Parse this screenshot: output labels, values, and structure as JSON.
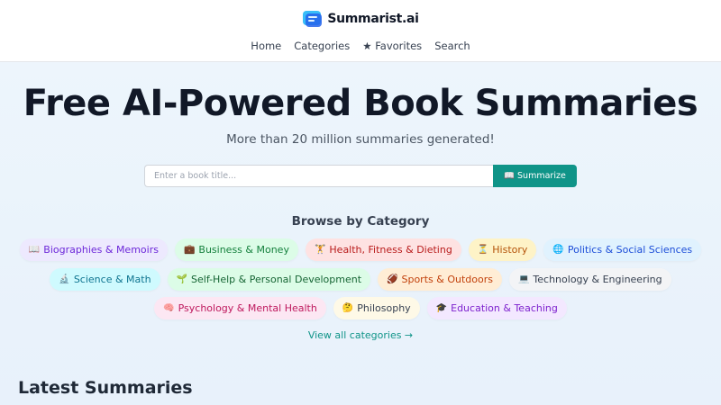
{
  "header": {
    "logo_text": "Summarist.ai",
    "nav": [
      {
        "label": "Home"
      },
      {
        "label": "Categories"
      },
      {
        "label": "★ Favorites"
      },
      {
        "label": "Search"
      }
    ]
  },
  "hero": {
    "title": "Free AI-Powered Book Summaries",
    "subtitle": "More than 20 million summaries generated!"
  },
  "search": {
    "placeholder": "Enter a book title...",
    "value": "",
    "button_label": "Summarize",
    "button_icon": "📖"
  },
  "browse": {
    "title": "Browse by Category",
    "categories": [
      {
        "icon": "📖",
        "label": "Biographies & Memoirs",
        "color": "#6d28d9"
      },
      {
        "icon": "💼",
        "label": "Business & Money",
        "color": "#15803d"
      },
      {
        "icon": "🏋",
        "label": "Health, Fitness & Dieting",
        "color": "#b91c1c"
      },
      {
        "icon": "⏳",
        "label": "History",
        "color": "#b45309"
      },
      {
        "icon": "🌐",
        "label": "Politics & Social Sciences",
        "color": "#1d4ed8"
      },
      {
        "icon": "🔬",
        "label": "Science & Math",
        "color": "#0e7490"
      },
      {
        "icon": "🌱",
        "label": "Self-Help & Personal Development",
        "color": "#166534"
      },
      {
        "icon": "🏈",
        "label": "Sports & Outdoors",
        "color": "#c2410c"
      },
      {
        "icon": "💻",
        "label": "Technology & Engineering",
        "color": "#374151"
      },
      {
        "icon": "🧠",
        "label": "Psychology & Mental Health",
        "color": "#be185d"
      },
      {
        "icon": "🤔",
        "label": "Philosophy",
        "color": "#374151"
      },
      {
        "icon": "🎓",
        "label": "Education & Teaching",
        "color": "#7e22ce"
      }
    ],
    "view_all_label": "View all categories →"
  },
  "latest": {
    "title": "Latest Summaries"
  },
  "colors": {
    "accent": "#0f9488",
    "title": "#111827"
  }
}
